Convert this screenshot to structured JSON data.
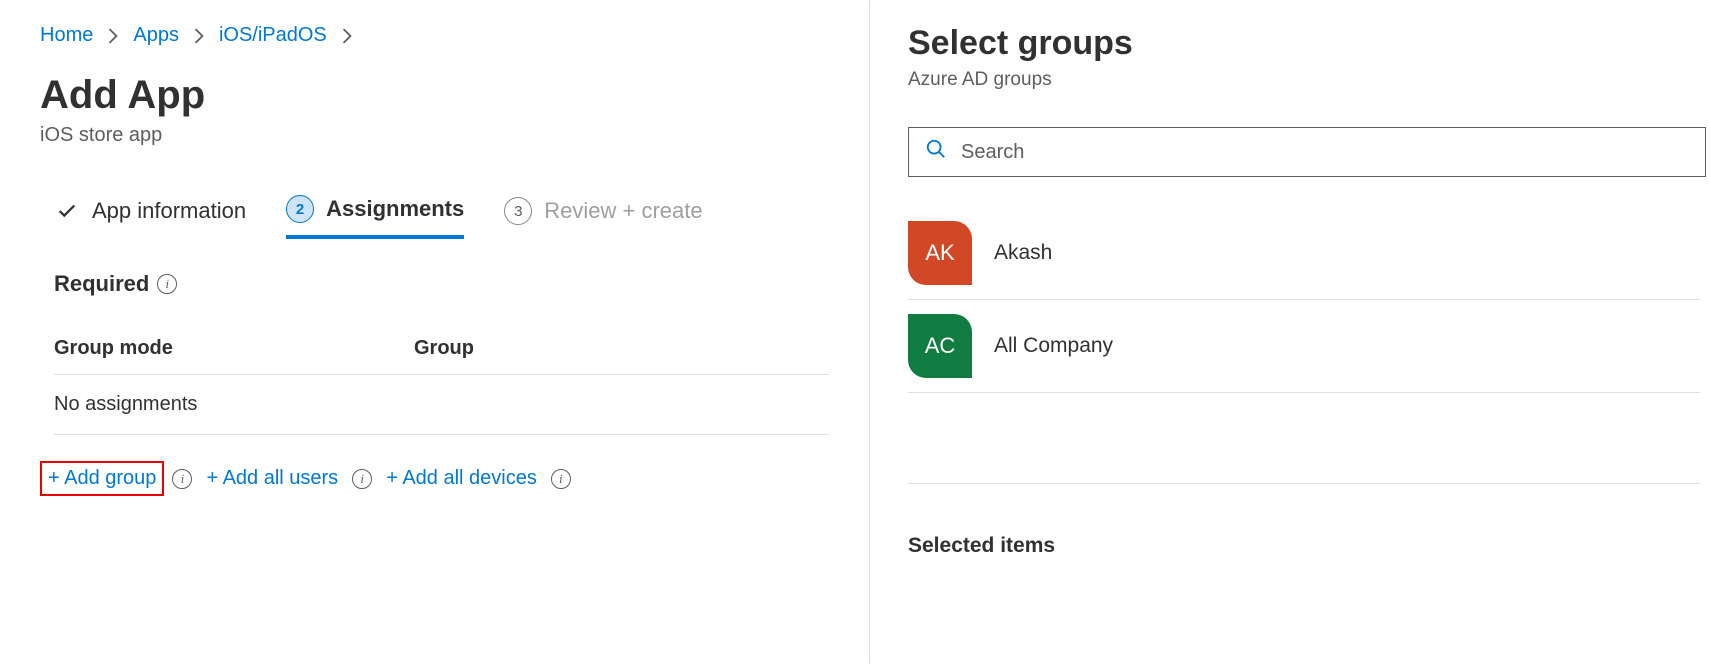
{
  "breadcrumb": {
    "items": [
      "Home",
      "Apps",
      "iOS/iPadOS"
    ]
  },
  "page": {
    "title": "Add App",
    "subtitle": "iOS store app"
  },
  "tabs": {
    "t1": {
      "label": "App information"
    },
    "t2": {
      "num": "2",
      "label": "Assignments"
    },
    "t3": {
      "num": "3",
      "label": "Review + create"
    }
  },
  "section": {
    "required": "Required"
  },
  "table": {
    "col_mode": "Group mode",
    "col_group": "Group",
    "empty": "No assignments"
  },
  "actions": {
    "add_group": "+ Add group",
    "add_all_users": "+ Add all users",
    "add_all_devices": "+ Add all devices"
  },
  "panel": {
    "title": "Select groups",
    "subtitle": "Azure AD groups",
    "search_placeholder": "Search",
    "selected_heading": "Selected items"
  },
  "groups": [
    {
      "initials": "AK",
      "name": "Akash",
      "color": "#d24726"
    },
    {
      "initials": "AC",
      "name": "All Company",
      "color": "#107c41"
    }
  ]
}
